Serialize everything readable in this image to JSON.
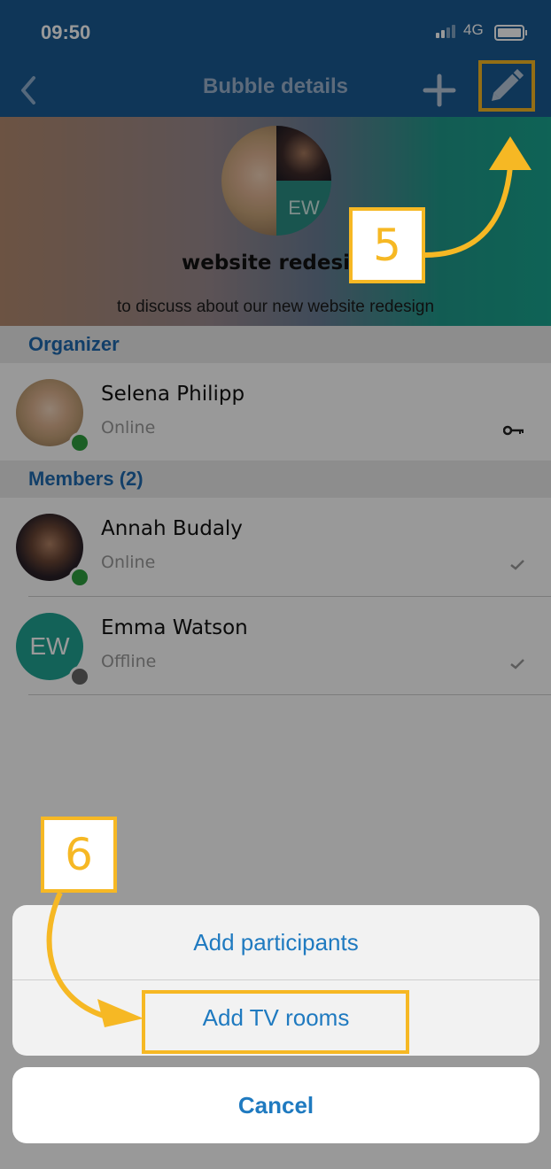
{
  "status_bar": {
    "time": "09:50",
    "network": "4G"
  },
  "nav": {
    "title": "Bubble details"
  },
  "bubble": {
    "name": "website redesign",
    "description": "to discuss about our new website redesign",
    "avatar_initials": "EW"
  },
  "sections": {
    "organizer": "Organizer",
    "members": "Members (2)"
  },
  "organizer": {
    "name": "Selena Philipp",
    "status": "Online"
  },
  "members": [
    {
      "name": "Annah Budaly",
      "status": "Online"
    },
    {
      "name": "Emma Watson",
      "status": "Offline",
      "initials": "EW"
    }
  ],
  "action_sheet": {
    "items": [
      "Add participants",
      "Add TV rooms"
    ],
    "cancel": "Cancel"
  },
  "annotations": {
    "step5": "5",
    "step6": "6"
  },
  "colors": {
    "primary": "#1a5a93",
    "accent": "#1f7ac0",
    "highlight": "#f6b824",
    "online": "#2e9e3e",
    "offline": "#666666",
    "initials_bg": "#20a393"
  }
}
